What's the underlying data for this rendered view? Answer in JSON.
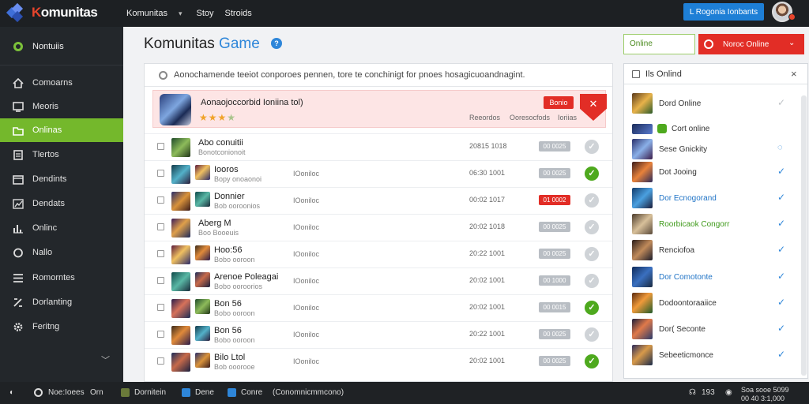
{
  "app": {
    "name": "Komunitas",
    "topnav": [
      "Komunitas",
      "Stoy",
      "Stroids"
    ],
    "cta_label": "L Rogonia Ionbants"
  },
  "sidebar": {
    "header": "Nontuiis",
    "items": [
      {
        "label": "Comoarns",
        "icon": "home-icon"
      },
      {
        "label": "Meoris",
        "icon": "monitor-icon"
      },
      {
        "label": "Onlinas",
        "icon": "folder-icon",
        "active": true
      },
      {
        "label": "Tlertos",
        "icon": "document-icon"
      },
      {
        "label": "Dendints",
        "icon": "calendar-icon"
      },
      {
        "label": "Dendats",
        "icon": "chart-icon"
      },
      {
        "label": "Onlinc",
        "icon": "bar-chart-icon"
      },
      {
        "label": "Nallo",
        "icon": "circle-icon"
      },
      {
        "label": "Romorntes",
        "icon": "list-icon"
      },
      {
        "label": "Dorlanting",
        "icon": "settings-icon"
      },
      {
        "label": "Feritng",
        "icon": "gear-icon"
      }
    ]
  },
  "main": {
    "title_main": "Komunitas ",
    "title_accent": "Game",
    "info_badge": "?",
    "online_field": "Online",
    "online_button": "Noroc Online",
    "search_value": "Aonochamende teeiot conporoes pennen, tore te conchinigt for pnoes hosagicuoandnagint.",
    "featured": {
      "name": "Aonaojoccorbid Ioniina tol)",
      "stars": "★★★",
      "stars_dim": "★",
      "badge": "Bonio",
      "corner_icon": "✕",
      "meta": [
        "Reeordos",
        "Ooresocfods",
        "Ioriias"
      ]
    },
    "rows": [
      {
        "title": "Abo conuitii",
        "sub": "Bonotconionoit",
        "col3": "",
        "num": "20815 1018",
        "pill": "00 0025",
        "pill_red": false,
        "checked": false,
        "double": false
      },
      {
        "title": "Iooros",
        "sub": "Bopy onoaonoi",
        "col3": "IOoniloc",
        "num": "06:30 1001",
        "pill": "00 0025",
        "pill_red": false,
        "checked": true,
        "double": true
      },
      {
        "title": "Donnier",
        "sub": "Bob ooroonios",
        "col3": "IOoniloc",
        "num": "00:02 1017",
        "pill": "01 0002",
        "pill_red": true,
        "checked": false,
        "double": true
      },
      {
        "title": "Aberg M",
        "sub": "Boo Booeuis",
        "col3": "IOoniloc",
        "num": "20:02 1018",
        "pill": "00 0025",
        "pill_red": false,
        "checked": false,
        "double": false
      },
      {
        "title": "Hoo:56",
        "sub": "Bobo ooroon",
        "col3": "IOoniloc",
        "num": "20:22 1001",
        "pill": "00 0025",
        "pill_red": false,
        "checked": false,
        "double": true
      },
      {
        "title": "Arenoe Poleagai",
        "sub": "Bobo ooroorios",
        "col3": "IOoniloc",
        "num": "20:02 1001",
        "pill": "00 1000",
        "pill_red": false,
        "checked": false,
        "double": true
      },
      {
        "title": "Bon 56",
        "sub": "Bobo ooroon",
        "col3": "IOoniloc",
        "num": "20:02 1001",
        "pill": "00 0015",
        "pill_red": false,
        "checked": true,
        "double": true
      },
      {
        "title": "Bon 56",
        "sub": "Bobo ooroon",
        "col3": "IOoniloc",
        "num": "20:22 1001",
        "pill": "00 0025",
        "pill_red": false,
        "checked": false,
        "double": true
      },
      {
        "title": "Bilo Ltol",
        "sub": "Bob ooorooe",
        "col3": "IOoniloc",
        "num": "20:02 1001",
        "pill": "00 0025",
        "pill_red": false,
        "checked": true,
        "double": true
      }
    ]
  },
  "rpanel": {
    "title": "Ils Onlind",
    "close": "×",
    "items": [
      {
        "label": "Dord Online",
        "style": "",
        "tick": "grey",
        "small": false
      },
      {
        "label": "Cort online",
        "style": "",
        "tick": "none",
        "small": true
      },
      {
        "label": "Sese Gnickity",
        "style": "",
        "tick": "spin",
        "small": false
      },
      {
        "label": "Dot Jooing",
        "style": "",
        "tick": "blue",
        "small": false
      },
      {
        "label": "Dor Ecnogorand",
        "style": "blue",
        "tick": "blue",
        "small": false
      },
      {
        "label": "Roorbicaok Congorr",
        "style": "green",
        "tick": "blue",
        "small": false
      },
      {
        "label": "Renciofoa",
        "style": "",
        "tick": "blue",
        "small": false
      },
      {
        "label": "Dor Comotonte",
        "style": "blue",
        "tick": "blue",
        "small": false
      },
      {
        "label": "Dodoontoraaiice",
        "style": "",
        "tick": "blue",
        "small": false
      },
      {
        "label": "Dor( Seconte",
        "style": "",
        "tick": "blue",
        "small": false
      },
      {
        "label": "Sebeeticmonce",
        "style": "",
        "tick": "blue",
        "small": false
      }
    ]
  },
  "bottombar": {
    "left": [
      "Noe:Ioees",
      "Orn",
      "Dornitein",
      "Dene",
      "Conre",
      "(Conomnicmmcono)"
    ],
    "right": [
      "193",
      "Soa sooe 5099",
      "00 40 3:1,000"
    ]
  },
  "colors": {
    "accent_green": "#74b82c",
    "accent_red": "#e22d26",
    "accent_blue": "#1e7fd6",
    "dark_bg": "#1d2023"
  }
}
